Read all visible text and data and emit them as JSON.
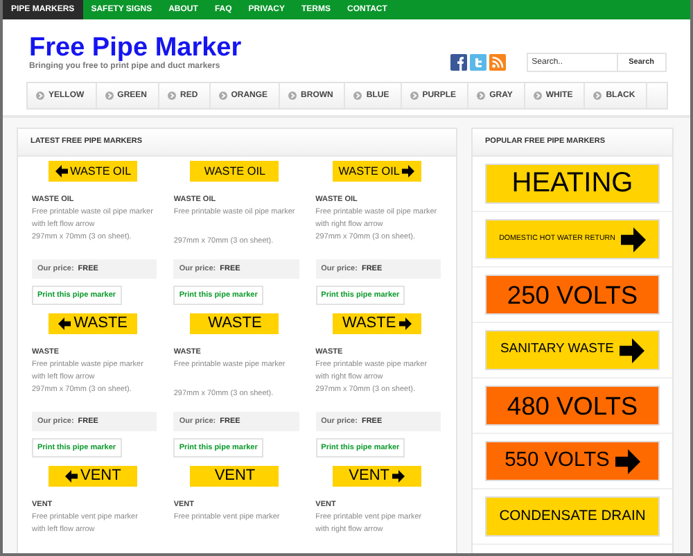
{
  "top_nav": [
    {
      "label": "PIPE MARKERS",
      "selected": true
    },
    {
      "label": "SAFETY SIGNS",
      "selected": false
    },
    {
      "label": "ABOUT",
      "selected": false
    },
    {
      "label": "FAQ",
      "selected": false
    },
    {
      "label": "PRIVACY",
      "selected": false
    },
    {
      "label": "TERMS",
      "selected": false
    },
    {
      "label": "CONTACT",
      "selected": false
    }
  ],
  "header": {
    "title": "Free Pipe Marker",
    "tagline": "Bringing you free to print pipe and duct markers"
  },
  "search": {
    "placeholder": "Search..",
    "button": "Search"
  },
  "color_nav": [
    "YELLOW",
    "GREEN",
    "RED",
    "ORANGE",
    "BROWN",
    "BLUE",
    "PURPLE",
    "GRAY",
    "WHITE",
    "BLACK"
  ],
  "latest": {
    "heading": "LATEST FREE PIPE MARKERS",
    "products": [
      {
        "marker": {
          "text": "WASTE OIL",
          "kind": "left-arrow",
          "color": "#ffd200"
        },
        "title": "WASTE OIL",
        "description": [
          "Free printable waste oil pipe marker",
          "with left flow arrow",
          "297mm x 70mm (3 on sheet)."
        ],
        "price_label": "Our price:",
        "price": "FREE",
        "action": "Print this pipe marker"
      },
      {
        "marker": {
          "text": "WASTE OIL",
          "kind": "plain",
          "color": "#ffd200"
        },
        "title": "WASTE OIL",
        "description": [
          "Free printable waste oil pipe marker",
          "297mm x 70mm (3 on sheet)."
        ],
        "price_label": "Our price:",
        "price": "FREE",
        "action": "Print this pipe marker"
      },
      {
        "marker": {
          "text": "WASTE OIL",
          "kind": "right-arrow",
          "color": "#ffd200"
        },
        "title": "WASTE OIL",
        "description": [
          "Free printable waste oil pipe marker",
          "with right flow arrow",
          "297mm x 70mm (3 on sheet)."
        ],
        "price_label": "Our price:",
        "price": "FREE",
        "action": "Print this pipe marker"
      },
      {
        "marker": {
          "text": "WASTE",
          "kind": "left-arrow",
          "color": "#ffd200"
        },
        "title": "WASTE",
        "description": [
          "Free printable waste pipe marker",
          "with left flow arrow",
          "297mm x 70mm (3 on sheet)."
        ],
        "price_label": "Our price:",
        "price": "FREE",
        "action": "Print this pipe marker"
      },
      {
        "marker": {
          "text": "WASTE",
          "kind": "plain",
          "color": "#ffd200"
        },
        "title": "WASTE",
        "description": [
          "Free printable waste pipe marker",
          "297mm x 70mm (3 on sheet)."
        ],
        "price_label": "Our price:",
        "price": "FREE",
        "action": "Print this pipe marker"
      },
      {
        "marker": {
          "text": "WASTE",
          "kind": "right-arrow",
          "color": "#ffd200"
        },
        "title": "WASTE",
        "description": [
          "Free printable waste pipe marker",
          "with right flow arrow",
          "297mm x 70mm (3 on sheet)."
        ],
        "price_label": "Our price:",
        "price": "FREE",
        "action": "Print this pipe marker"
      },
      {
        "marker": {
          "text": "VENT",
          "kind": "left-arrow",
          "color": "#ffd200"
        },
        "title": "VENT",
        "description": [
          "Free printable vent pipe marker",
          "with left flow arrow"
        ]
      },
      {
        "marker": {
          "text": "VENT",
          "kind": "plain",
          "color": "#ffd200"
        },
        "title": "VENT",
        "description": [
          "Free printable vent pipe marker"
        ]
      },
      {
        "marker": {
          "text": "VENT",
          "kind": "right-arrow",
          "color": "#ffd200"
        },
        "title": "VENT",
        "description": [
          "Free printable vent pipe marker",
          "with right flow arrow"
        ]
      }
    ]
  },
  "popular": {
    "heading": "POPULAR FREE PIPE MARKERS",
    "markers": [
      {
        "text": "HEATING",
        "kind": "plain",
        "color": "#ffd200"
      },
      {
        "text": "DOMESTIC HOT WATER RETURN",
        "kind": "right-arrow",
        "color": "#ffd200"
      },
      {
        "text": "250 VOLTS",
        "kind": "plain",
        "color": "#ff6a00"
      },
      {
        "text": "SANITARY WASTE",
        "kind": "right-arrow",
        "color": "#ffd200"
      },
      {
        "text": "480 VOLTS",
        "kind": "plain",
        "color": "#ff6a00"
      },
      {
        "text": "550 VOLTS",
        "kind": "right-arrow",
        "color": "#ff6a00"
      },
      {
        "text": "CONDENSATE DRAIN",
        "kind": "plain",
        "color": "#ffd200"
      }
    ]
  }
}
